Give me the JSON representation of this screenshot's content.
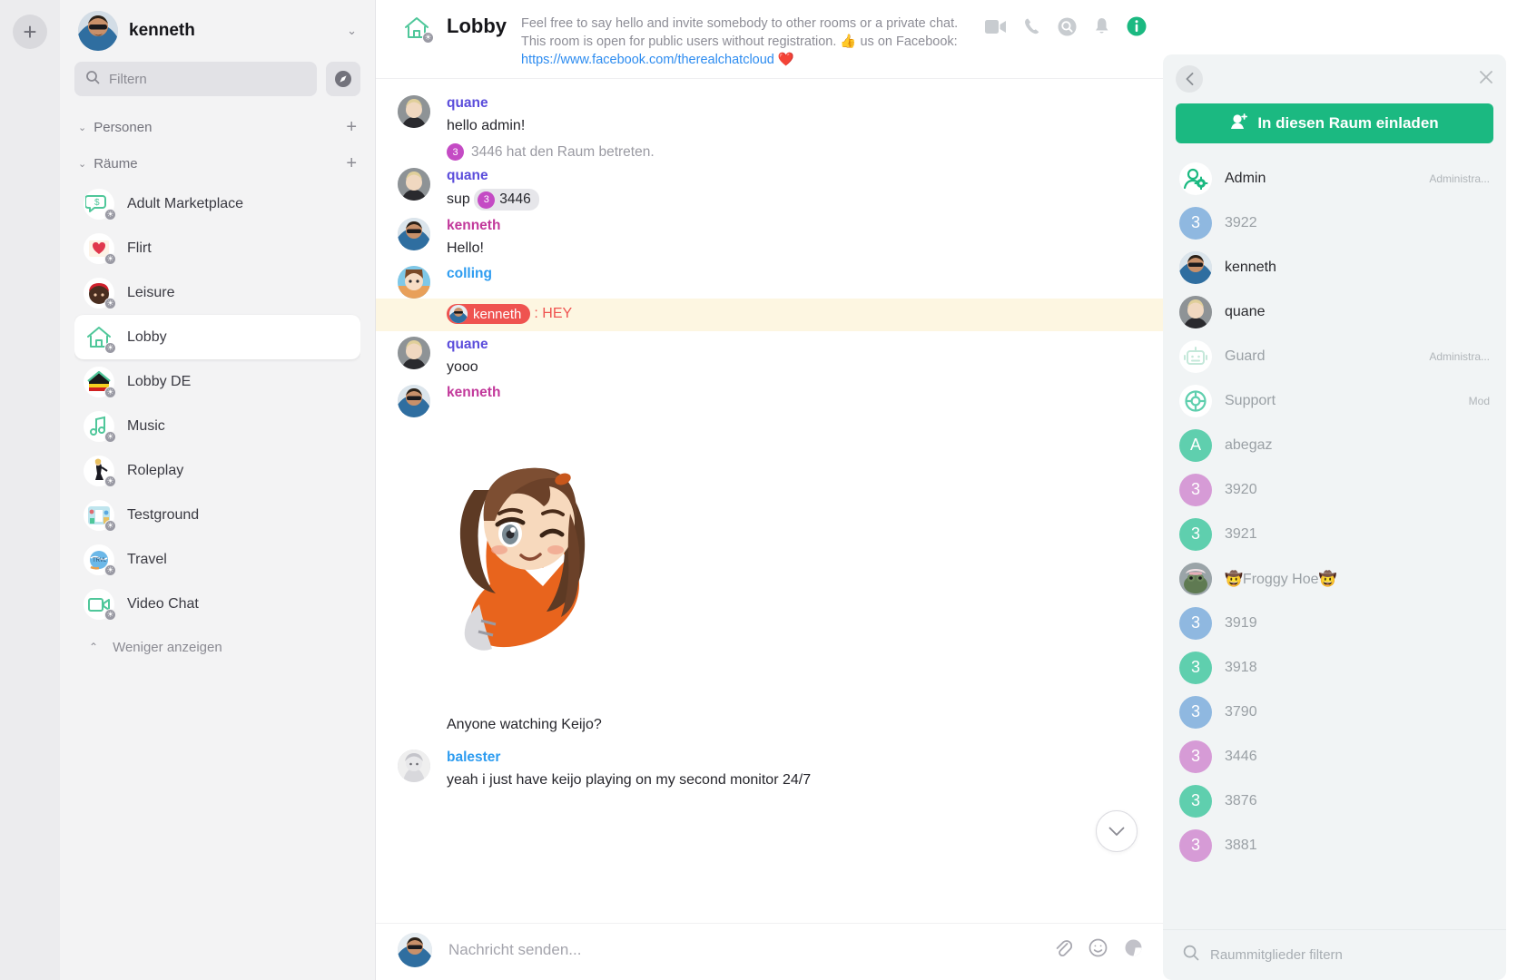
{
  "rail": {
    "add_label": "+",
    "add_name": "add-button"
  },
  "sidebar": {
    "user": {
      "name": "kenneth",
      "chevron": "⌄"
    },
    "search": {
      "placeholder": "Filtern",
      "value": ""
    },
    "compass_icon": "compass-icon",
    "groups": [
      {
        "label": "Personen",
        "chevron": "⌄",
        "plus": "+"
      },
      {
        "label": "Räume",
        "chevron": "⌄",
        "plus": "+"
      }
    ],
    "rooms": [
      {
        "label": "Adult Marketplace",
        "emoji": "💬",
        "active": false
      },
      {
        "label": "Flirt",
        "emoji": "💌",
        "active": false
      },
      {
        "label": "Leisure",
        "emoji": "🎩",
        "active": false
      },
      {
        "label": "Lobby",
        "emoji": "🏠",
        "active": true
      },
      {
        "label": "Lobby DE",
        "emoji": "🏡",
        "active": false
      },
      {
        "label": "Music",
        "emoji": "🎵",
        "active": false
      },
      {
        "label": "Roleplay",
        "emoji": "💃",
        "active": false
      },
      {
        "label": "Testground",
        "emoji": "🏙",
        "active": false
      },
      {
        "label": "Travel",
        "emoji": "🌍",
        "active": false
      },
      {
        "label": "Video Chat",
        "emoji": "📹",
        "active": false
      }
    ],
    "show_less": {
      "label": "Weniger anzeigen",
      "chevron": "⌃"
    }
  },
  "header": {
    "room_title": "Lobby",
    "topic_part1": "Feel free to say hello and invite somebody to other rooms or a private chat. This room is open for public users without registration. ",
    "topic_thumb": "👍",
    "topic_part2": " us on Facebook: ",
    "topic_link": "https://www.facebook.com/therealchatcloud",
    "topic_heart": " ❤️",
    "icons": [
      "video-camera-icon",
      "phone-icon",
      "search-icon",
      "bell-icon",
      "info-icon"
    ]
  },
  "messages": [
    {
      "type": "message",
      "author": "quane",
      "author_color": "#5b4ddb",
      "text": "hello admin!",
      "system": {
        "badge": "3",
        "badge_color": "#c44bc4",
        "text": "3446 hat den Raum betreten."
      }
    },
    {
      "type": "chip",
      "author": "quane",
      "author_color": "#5b4ddb",
      "prefix": "sup ",
      "chip_badge": "3",
      "chip_badge_color": "#c44bc4",
      "chip_label": "3446"
    },
    {
      "type": "message",
      "author": "kenneth",
      "author_color": "#c2399b",
      "text": "Hello!"
    },
    {
      "type": "highlight",
      "author": "colling",
      "author_color": "#2d9cf0",
      "mention": "kenneth",
      "text": ": HEY"
    },
    {
      "type": "message",
      "author": "quane",
      "author_color": "#5b4ddb",
      "text": "yooo"
    },
    {
      "type": "sticker",
      "author": "kenneth",
      "author_color": "#c2399b",
      "sticker_name": "anime-girl-sticker",
      "caption": "Anyone watching Keijo?"
    },
    {
      "type": "message",
      "author": "balester",
      "author_color": "#2d9cf0",
      "text": "yeah i just have keijo playing on my second monitor 24/7"
    }
  ],
  "composer": {
    "placeholder": "Nachricht senden...",
    "icons": [
      "attachment-icon",
      "emoji-icon",
      "sticker-icon"
    ]
  },
  "scroll_down_icon": "chevron-down-icon",
  "right_panel": {
    "back_icon": "chevron-left-icon",
    "close_icon": "close-icon",
    "invite_label": "In diesen Raum einladen",
    "invite_icon": "add-user-icon",
    "invite_color": "#1bb981",
    "filter_placeholder": "Raummitglieder filtern",
    "members": [
      {
        "name": "Admin",
        "role": "Administra...",
        "avatar": "admin-gear-icon",
        "kind": "badge",
        "color": "#1bb981",
        "muted": false
      },
      {
        "name": "3922",
        "role": "",
        "kind": "num",
        "initial": "3",
        "color": "#8fb8e0",
        "muted": true
      },
      {
        "name": "kenneth",
        "role": "",
        "kind": "photo",
        "photo": "kenneth",
        "muted": false
      },
      {
        "name": "quane",
        "role": "",
        "kind": "photo",
        "photo": "quane",
        "muted": false
      },
      {
        "name": "Guard",
        "role": "Administra...",
        "kind": "badge",
        "avatar": "robot-icon",
        "color": "#bfe6d6",
        "muted": true
      },
      {
        "name": "Support",
        "role": "Mod",
        "kind": "badge",
        "avatar": "lifebuoy-icon",
        "color": "#5fcfae",
        "muted": true
      },
      {
        "name": "abegaz",
        "role": "",
        "kind": "num",
        "initial": "A",
        "color": "#5fcfae",
        "muted": true
      },
      {
        "name": "3920",
        "role": "",
        "kind": "num",
        "initial": "3",
        "color": "#d69bd6",
        "muted": true
      },
      {
        "name": "3921",
        "role": "",
        "kind": "num",
        "initial": "3",
        "color": "#5fcfae",
        "muted": true
      },
      {
        "name": "🤠Froggy Hoe🤠",
        "role": "",
        "kind": "photo",
        "photo": "froggy",
        "muted": true
      },
      {
        "name": "3919",
        "role": "",
        "kind": "num",
        "initial": "3",
        "color": "#8fb8e0",
        "muted": true
      },
      {
        "name": "3918",
        "role": "",
        "kind": "num",
        "initial": "3",
        "color": "#5fcfae",
        "muted": true
      },
      {
        "name": "3790",
        "role": "",
        "kind": "num",
        "initial": "3",
        "color": "#8fb8e0",
        "muted": true
      },
      {
        "name": "3446",
        "role": "",
        "kind": "num",
        "initial": "3",
        "color": "#d69bd6",
        "muted": true
      },
      {
        "name": "3876",
        "role": "",
        "kind": "num",
        "initial": "3",
        "color": "#5fcfae",
        "muted": true
      },
      {
        "name": "3881",
        "role": "",
        "kind": "num",
        "initial": "3",
        "color": "#d69bd6",
        "muted": true
      }
    ]
  }
}
